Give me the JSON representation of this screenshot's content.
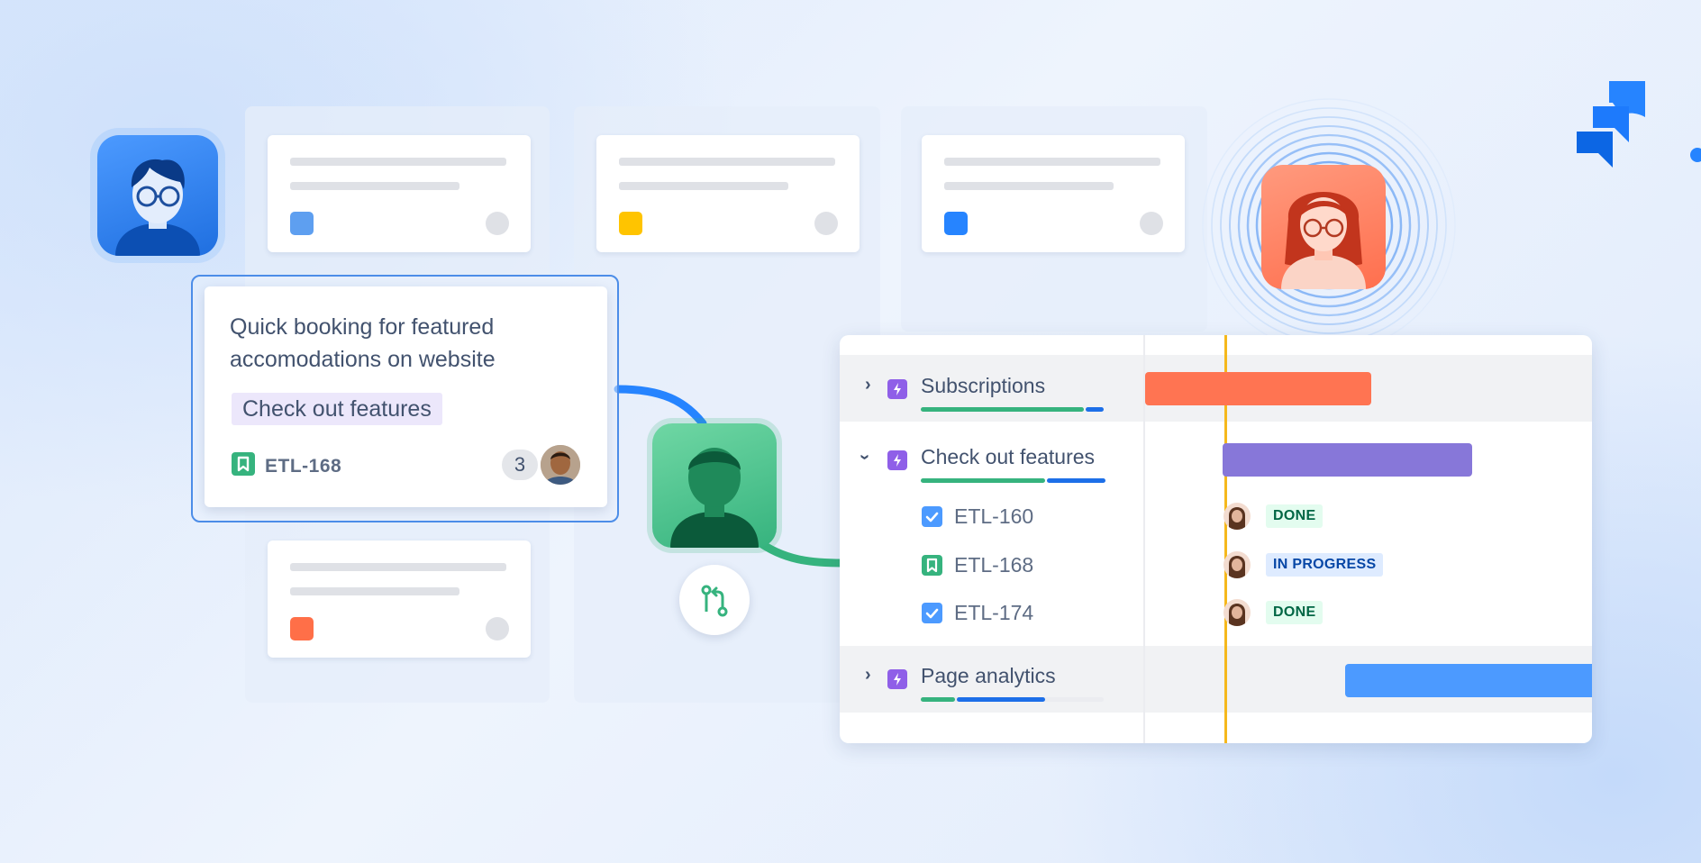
{
  "colors": {
    "primary_blue": "#2684ff",
    "epic_purple": "#8f5fe8",
    "story_green": "#36b37e",
    "task_blue": "#4c9aff",
    "bar_orange": "#ff7452",
    "bar_purple": "#8777d9",
    "bar_blue": "#4c9aff",
    "today_line": "#f5b81c"
  },
  "board": {
    "columns": [
      {
        "cards": [
          {
            "color": "#5e9ff0"
          },
          {
            "color": "#ff6f48"
          }
        ]
      },
      {
        "cards": [
          {
            "color": "#ffc400"
          }
        ]
      },
      {
        "cards": [
          {
            "color": "#2684ff"
          }
        ]
      }
    ]
  },
  "issue_card": {
    "title": "Quick booking for featured accomodations on website",
    "epic_chip": "Check out features",
    "key": "ETL-168",
    "icon": "story-icon",
    "comment_count": "3",
    "assignee_icon": "assignee-avatar"
  },
  "actors": {
    "left_avatar": "man-with-glasses-avatar",
    "center_avatar": "green-person-avatar",
    "right_avatar": "woman-with-glasses-avatar",
    "pull_request_icon": "pull-request-icon",
    "logo_icon": "jira-logo-icon"
  },
  "timeline": {
    "epics": [
      {
        "name": "Subscriptions",
        "expanded": false,
        "progress_done": 0.88,
        "progress_in_progress": 0.1
      },
      {
        "name": "Check out features",
        "expanded": true,
        "progress_done": 0.67,
        "progress_in_progress": 0.32,
        "children": [
          {
            "key": "ETL-160",
            "type": "task",
            "status": "DONE"
          },
          {
            "key": "ETL-168",
            "type": "story",
            "status": "IN PROGRESS"
          },
          {
            "key": "ETL-174",
            "type": "task",
            "status": "DONE"
          }
        ]
      },
      {
        "name": "Page analytics",
        "expanded": false,
        "progress_done": 0.19,
        "progress_in_progress": 0.48
      }
    ]
  }
}
